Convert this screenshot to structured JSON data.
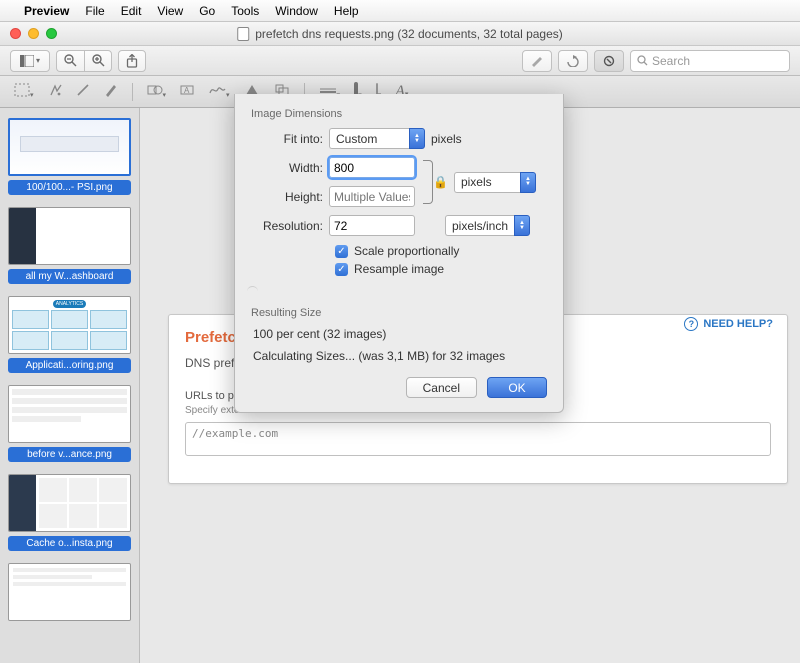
{
  "menubar": {
    "app": "Preview",
    "items": [
      "File",
      "Edit",
      "View",
      "Go",
      "Tools",
      "Window",
      "Help"
    ]
  },
  "titlebar": {
    "title": "prefetch dns requests.png (32 documents, 32 total pages)"
  },
  "toolbar": {
    "search_placeholder": "Search"
  },
  "sidebar": {
    "thumbs": [
      {
        "caption": "100/100...- PSI.png",
        "selected": true
      },
      {
        "caption": "all my W...ashboard"
      },
      {
        "caption": "Applicati...oring.png"
      },
      {
        "caption": "before v...ance.png"
      },
      {
        "caption": "Cache o...insta.png"
      },
      {
        "caption": ""
      }
    ]
  },
  "document": {
    "heading": "Prefetch DNS Re",
    "subtitle": "DNS prefetching ca",
    "field_label": "URLs to prefetc",
    "field_hint": "Specify external h",
    "textarea_value": "//example.com",
    "need_help": "NEED HELP?"
  },
  "dialog": {
    "section1_title": "Image Dimensions",
    "fit_label": "Fit into:",
    "fit_value": "Custom",
    "fit_unit": "pixels",
    "width_label": "Width:",
    "width_value": "800",
    "height_label": "Height:",
    "height_placeholder": "Multiple Values",
    "wh_unit": "pixels",
    "resolution_label": "Resolution:",
    "resolution_value": "72",
    "resolution_unit": "pixels/inch",
    "scale_label": "Scale proportionally",
    "resample_label": "Resample image",
    "section2_title": "Resulting Size",
    "result_line1": "100 per cent (32 images)",
    "result_line2": "Calculating Sizes... (was 3,1 MB) for 32 images",
    "cancel": "Cancel",
    "ok": "OK"
  }
}
